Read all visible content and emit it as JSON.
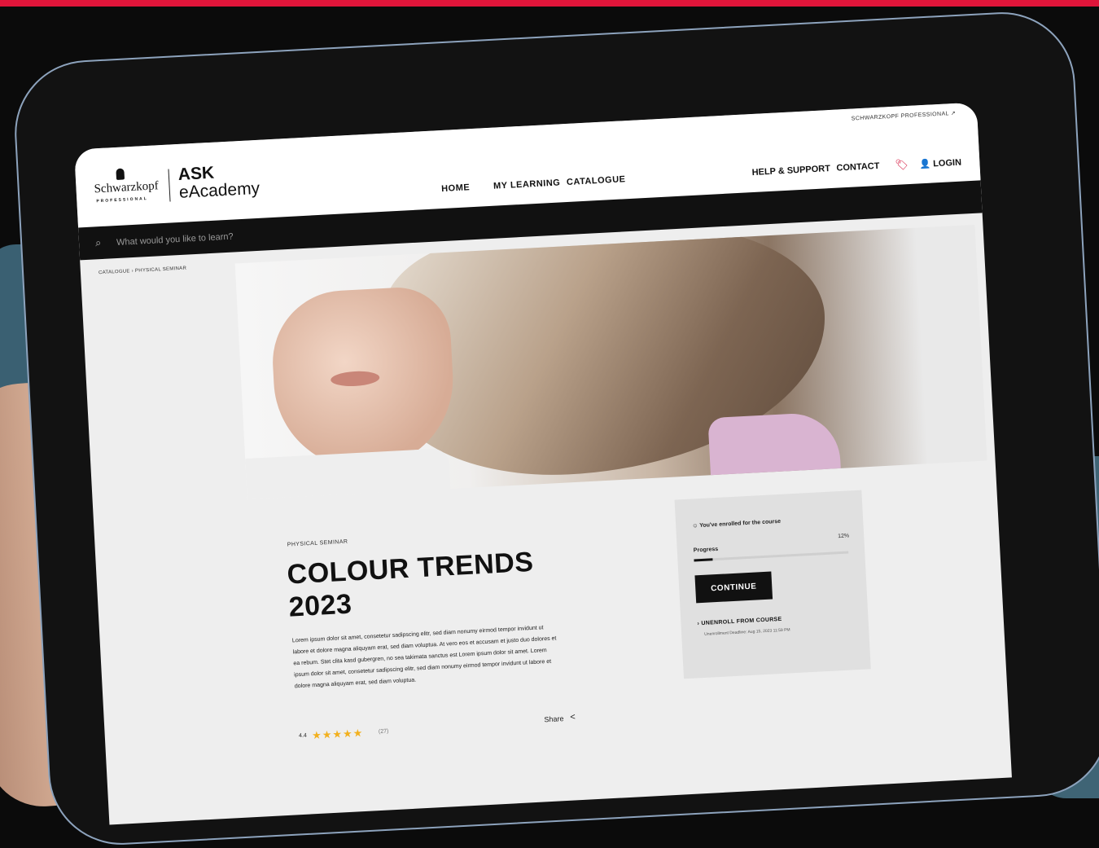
{
  "header": {
    "brand": "Schwarzkopf",
    "brand_sub": "PROFESSIONAL",
    "app_name_1": "ASK",
    "app_name_2": "eAcademy",
    "top_link": "SCHWARZKOPF PROFESSIONAL ↗",
    "nav": [
      "HOME",
      "MY LEARNING",
      "CATALOGUE"
    ],
    "help": "HELP & SUPPORT",
    "contact": "CONTACT",
    "login": "LOGIN"
  },
  "search": {
    "placeholder": "What would you like to learn?"
  },
  "breadcrumb": "CATALOGUE › PHYSICAL SEMINAR",
  "course": {
    "kicker": "PHYSICAL SEMINAR",
    "title": "COLOUR TRENDS 2023",
    "description": "Lorem ipsum dolor sit amet, consetetur sadipscing elitr, sed diam nonumy eirmod tempor invidunt ut labore et dolore magna aliquyam erat, sed diam voluptua. At vero eos et accusam et justo duo dolores et ea rebum. Stet clita kasd gubergren, no sea takimata sanctus est Lorem ipsum dolor sit amet. Lorem ipsum dolor sit amet, consetetur sadipscing elitr, sed diam nonumy eirmod tempor invidunt ut labore et dolore magna aliquyam erat, sed diam voluptua.",
    "rating": "4.4",
    "rating_count": "(27)",
    "share": "Share"
  },
  "enrollment": {
    "status": "You've enrolled for the course",
    "progress_label": "Progress",
    "progress_value": "12%",
    "progress_fraction": 0.12,
    "continue": "CONTINUE",
    "unenroll": "UNENROLL FROM COURSE",
    "deadline": "Unenrollment Deadline: Aug 15, 2023 11:59 PM"
  },
  "colors": {
    "accent": "#e0153a",
    "stars": "#f2b01e"
  }
}
